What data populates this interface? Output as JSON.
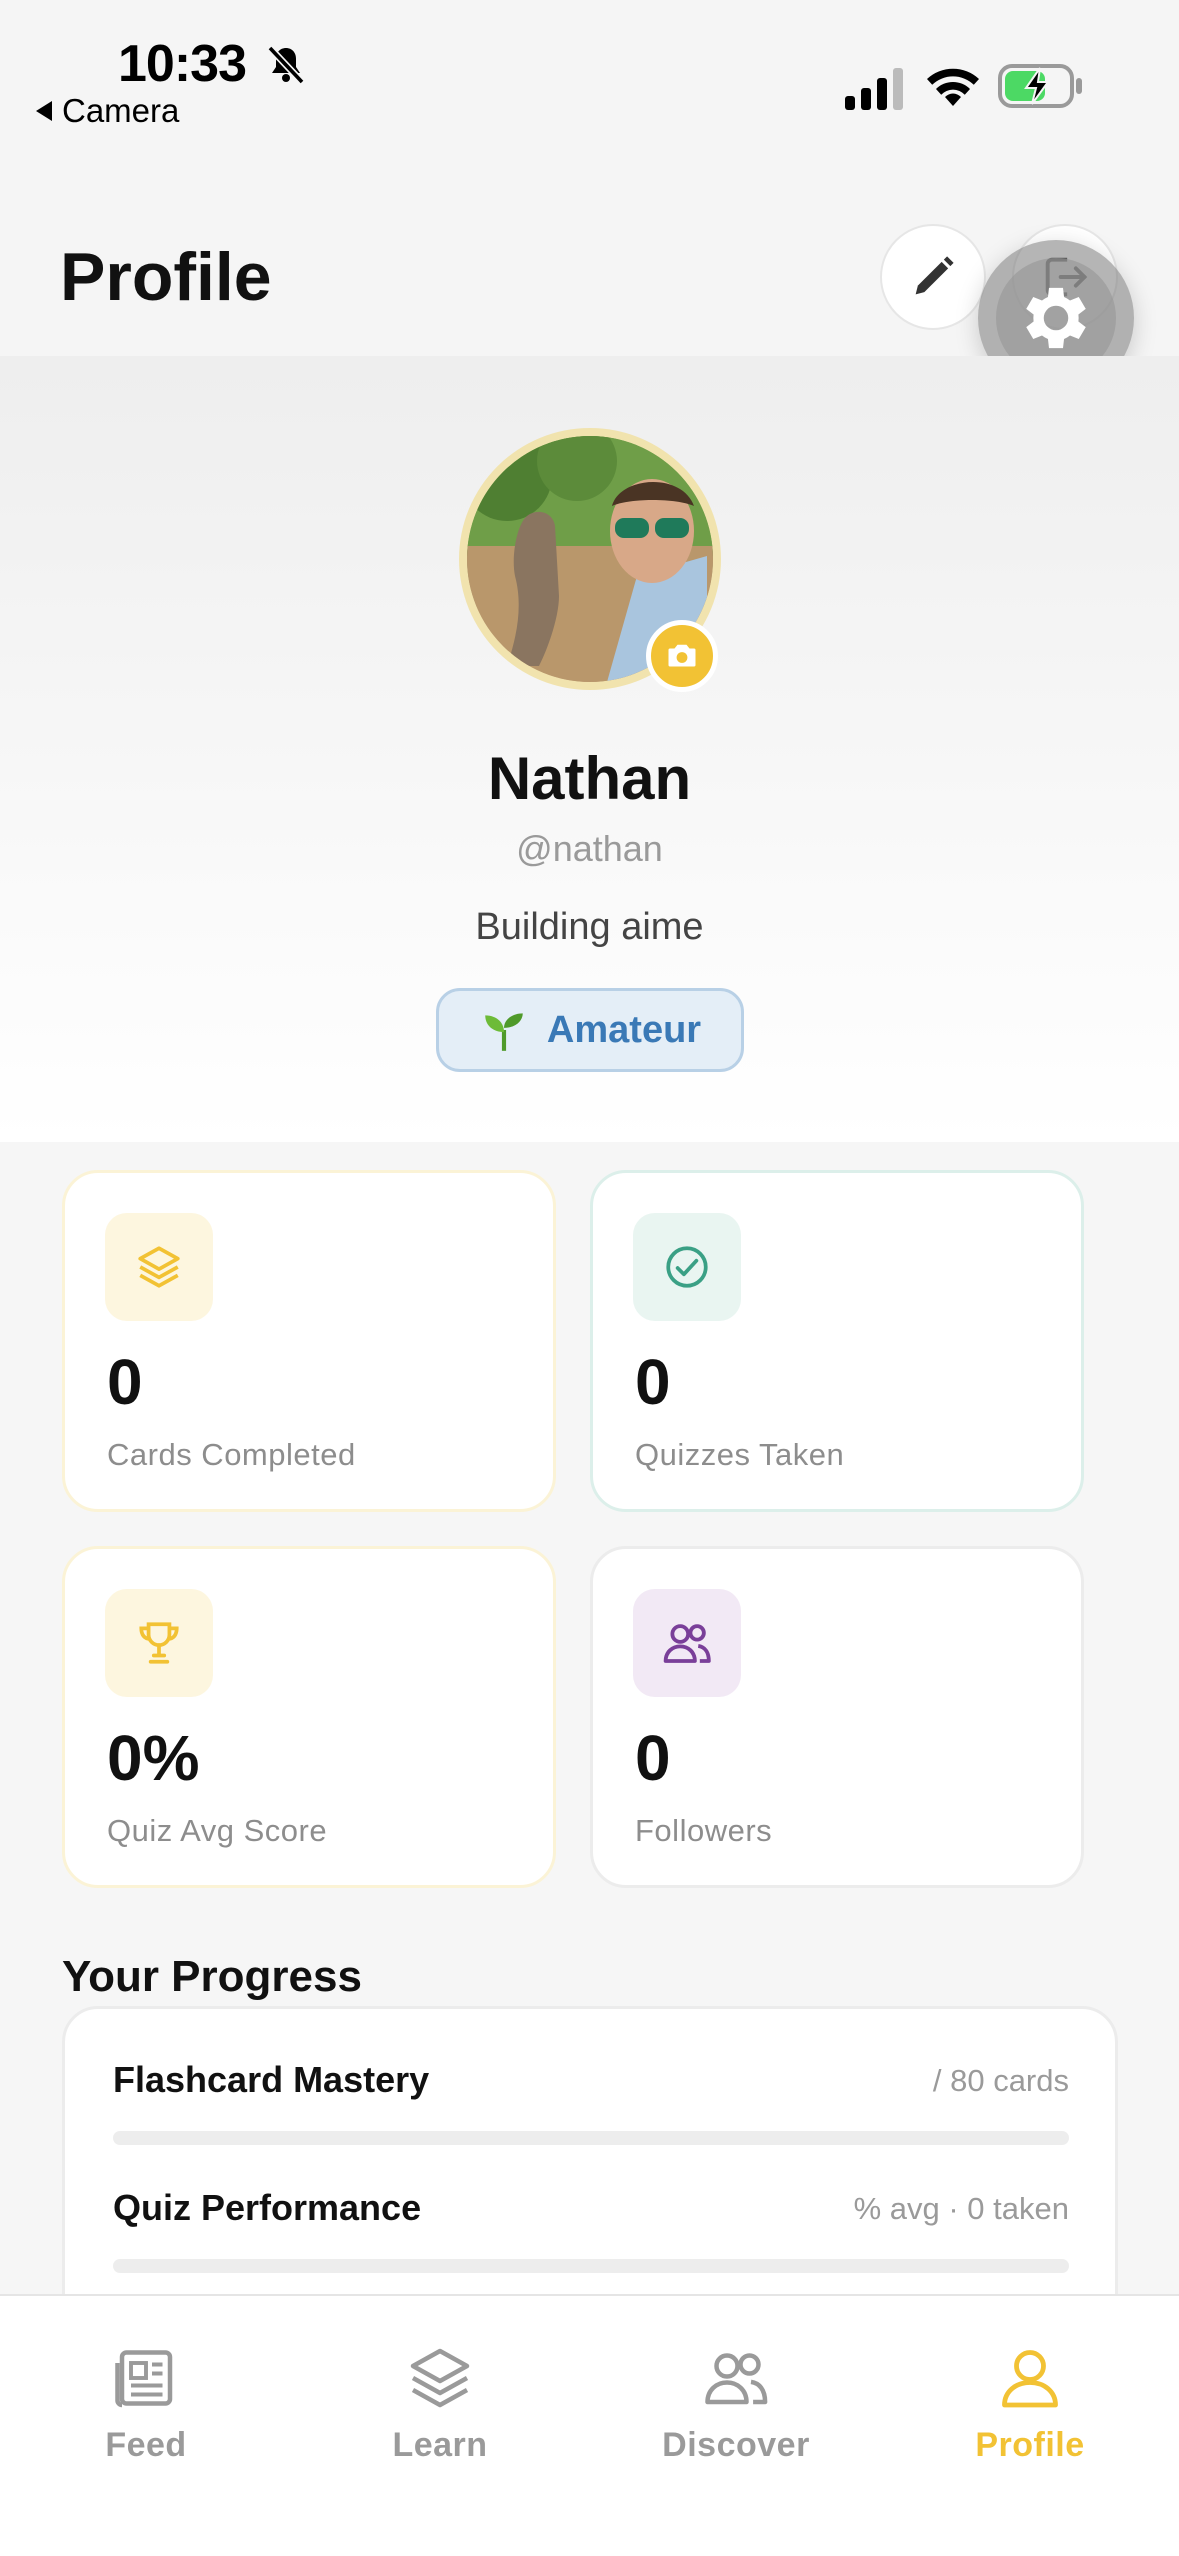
{
  "status": {
    "time": "10:33",
    "back_app": "Camera"
  },
  "header": {
    "title": "Profile"
  },
  "profile": {
    "name": "Nathan",
    "handle": "@nathan",
    "bio": "Building aime",
    "level": "Amateur",
    "level_icon": "seedling-icon"
  },
  "stats": [
    {
      "value": "0",
      "label": "Cards Completed",
      "icon": "layers-icon",
      "color": "#f2c234"
    },
    {
      "value": "0",
      "label": "Quizzes Taken",
      "icon": "check-circle-icon",
      "color": "#3aa085"
    },
    {
      "value": "0%",
      "label": "Quiz Avg Score",
      "icon": "trophy-icon",
      "color": "#f2c234"
    },
    {
      "value": "0",
      "label": "Followers",
      "icon": "users-icon",
      "color": "#7a3f99"
    }
  ],
  "progress": {
    "title": "Your Progress",
    "rows": [
      {
        "title": "Flashcard Mastery",
        "meta": "/ 80 cards",
        "fraction": 0
      },
      {
        "title": "Quiz Performance",
        "meta": "% avg · 0 taken",
        "fraction": 0
      }
    ]
  },
  "tabs": [
    {
      "label": "Feed",
      "icon": "newspaper-icon",
      "active": false
    },
    {
      "label": "Learn",
      "icon": "layers-icon",
      "active": false
    },
    {
      "label": "Discover",
      "icon": "users-icon",
      "active": false
    },
    {
      "label": "Profile",
      "icon": "person-icon",
      "active": true
    }
  ],
  "colors": {
    "accent": "#f2c234",
    "level_text": "#3a79b6",
    "teal": "#3aa085",
    "purple": "#7a3f99"
  }
}
